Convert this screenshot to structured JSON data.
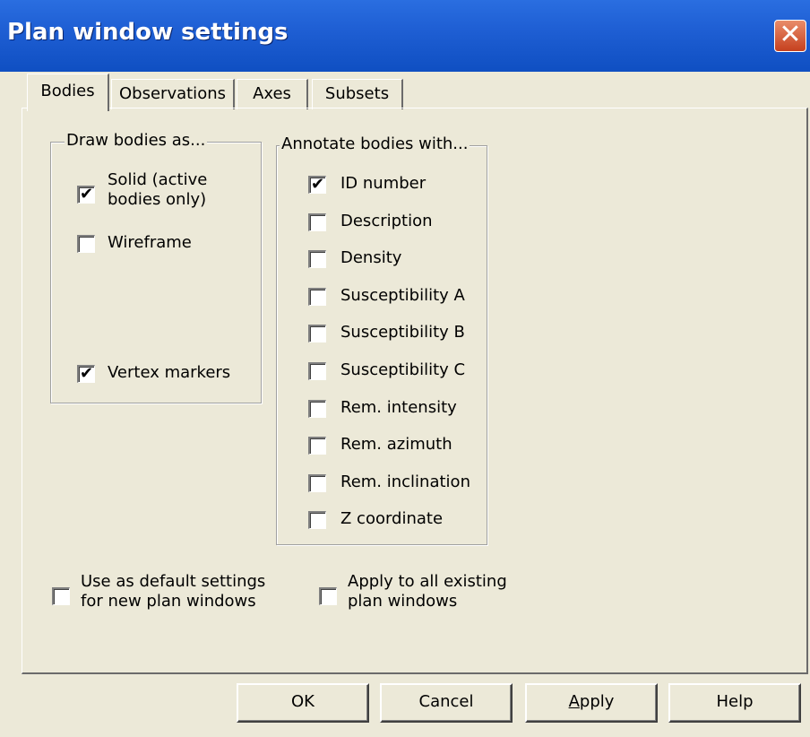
{
  "window": {
    "title": "Plan window settings",
    "close_glyph": "✕"
  },
  "tabs": [
    {
      "label": "Bodies",
      "active": true
    },
    {
      "label": "Observations",
      "active": false
    },
    {
      "label": "Axes",
      "active": false
    },
    {
      "label": "Subsets",
      "active": false
    }
  ],
  "draw_group": {
    "title": "Draw bodies as...",
    "solid": {
      "line1": "Solid (active",
      "line2": "bodies only)",
      "checked": true
    },
    "wireframe": {
      "label": "Wireframe",
      "checked": false
    },
    "vertex": {
      "label": "Vertex markers",
      "checked": true
    }
  },
  "annotate_group": {
    "title": "Annotate bodies with...",
    "items": [
      {
        "label": "ID number",
        "checked": true
      },
      {
        "label": "Description",
        "checked": false
      },
      {
        "label": "Density",
        "checked": false
      },
      {
        "label": "Susceptibility A",
        "checked": false
      },
      {
        "label": "Susceptibility B",
        "checked": false
      },
      {
        "label": "Susceptibility C",
        "checked": false
      },
      {
        "label": "Rem. intensity",
        "checked": false
      },
      {
        "label": "Rem. azimuth",
        "checked": false
      },
      {
        "label": "Rem. inclination",
        "checked": false
      },
      {
        "label": "Z coordinate",
        "checked": false
      }
    ]
  },
  "options": {
    "default": {
      "line1": "Use as default settings",
      "line2": "for new plan windows",
      "checked": false
    },
    "apply_all": {
      "line1": "Apply to all existing",
      "line2": "plan windows",
      "checked": false
    }
  },
  "buttons": {
    "ok": "OK",
    "cancel": "Cancel",
    "apply_mnemonic": "A",
    "apply_rest": "pply",
    "help": "Help"
  },
  "check_glyph": "✔"
}
